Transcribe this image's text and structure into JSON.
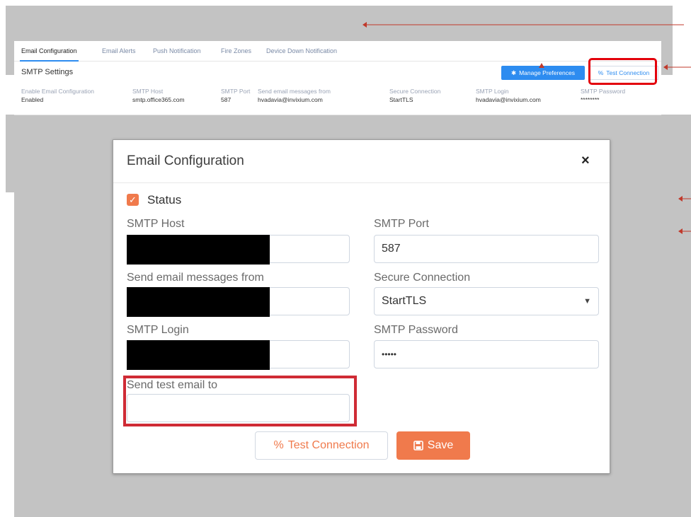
{
  "tabs": [
    {
      "label": "Email Configuration",
      "active": true
    },
    {
      "label": "Email Alerts",
      "active": false
    },
    {
      "label": "Push Notification",
      "active": false
    },
    {
      "label": "Fire Zones",
      "active": false
    },
    {
      "label": "Device Down Notification",
      "active": false
    }
  ],
  "smtp_settings": {
    "title": "SMTP Settings",
    "manage_preferences_label": "Manage Preferences",
    "test_connection_label": "Test Connection",
    "columns": [
      {
        "label": "Enable Email Configuration",
        "value": "Enabled"
      },
      {
        "label": "SMTP Host",
        "value": "smtp.office365.com"
      },
      {
        "label": "SMTP Port",
        "value": "587"
      },
      {
        "label": "Send email messages from",
        "value": "hvadavia@invixium.com"
      },
      {
        "label": "Secure Connection",
        "value": "StartTLS"
      },
      {
        "label": "SMTP Login",
        "value": "hvadavia@invixium.com"
      },
      {
        "label": "SMTP Password",
        "value": "********"
      }
    ]
  },
  "modal": {
    "title": "Email Configuration",
    "close_glyph": "×",
    "status_label": "Status",
    "status_checked": true,
    "fields": {
      "smtp_host_label": "SMTP Host",
      "smtp_port_label": "SMTP Port",
      "smtp_port_value": "587",
      "send_from_label": "Send email messages from",
      "secure_connection_label": "Secure Connection",
      "secure_connection_value": "StartTLS",
      "smtp_login_label": "SMTP Login",
      "smtp_password_label": "SMTP Password",
      "smtp_password_value": "•••••",
      "send_test_label": "Send test email to",
      "send_test_value": ""
    },
    "test_connection_label": "Test Connection",
    "save_label": "Save"
  },
  "colors": {
    "accent_orange": "#f07a4c",
    "primary_blue": "#2d8cf0",
    "highlight_red": "#e3000b",
    "backdrop_gray": "#c3c3c3"
  },
  "icons": {
    "manage_preferences": "gear-icon",
    "test_connection": "link-icon",
    "save": "floppy-disk-icon",
    "status_checkbox": "checkmark-icon",
    "secure_connection_dropdown": "caret-down-icon",
    "close": "close-icon"
  }
}
